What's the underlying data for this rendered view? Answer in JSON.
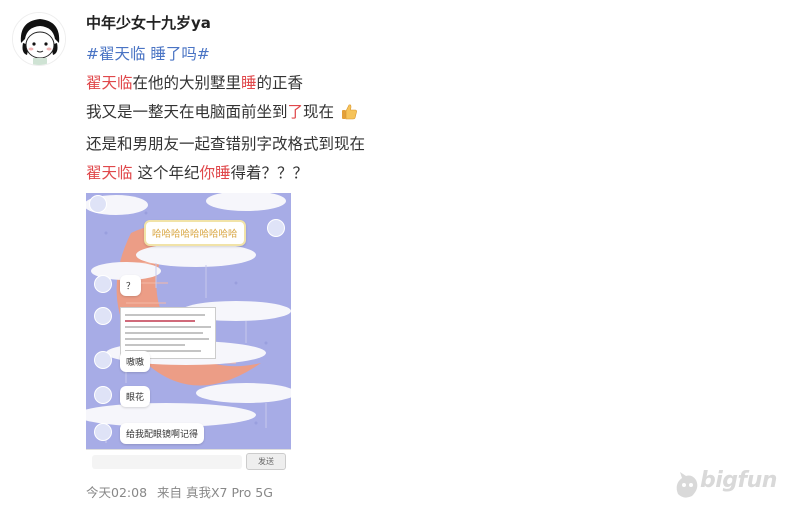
{
  "user": {
    "name": "中年少女十九岁ya"
  },
  "post": {
    "hashtag": "#翟天临 睡了吗#",
    "lines": [
      {
        "parts": [
          "翟天临",
          "在他的大别墅里",
          "睡",
          "的正香"
        ]
      },
      {
        "parts": [
          "我又是一整天在电脑面前坐到",
          "了",
          "现在"
        ]
      },
      {
        "parts": [
          "还是和男朋友一起查错别字改格式到现在"
        ]
      },
      {
        "parts": [
          "翟天临",
          " 这个年纪",
          "你睡",
          "得着？？？"
        ]
      }
    ]
  },
  "image": {
    "bubbles": [
      "哈哈哈哈哈哈哈哈哈",
      "？",
      "嗷嗷",
      "眼花",
      "给我配眼镜啊记得"
    ],
    "send_label": "发送"
  },
  "meta": {
    "time": "今天02:08",
    "source": "来自 真我X7 Pro 5G"
  },
  "watermark": {
    "text": "bigfun"
  },
  "colors": {
    "hashtag": "#4a74c4",
    "highlight": "#e0484b",
    "meta": "#888888"
  }
}
